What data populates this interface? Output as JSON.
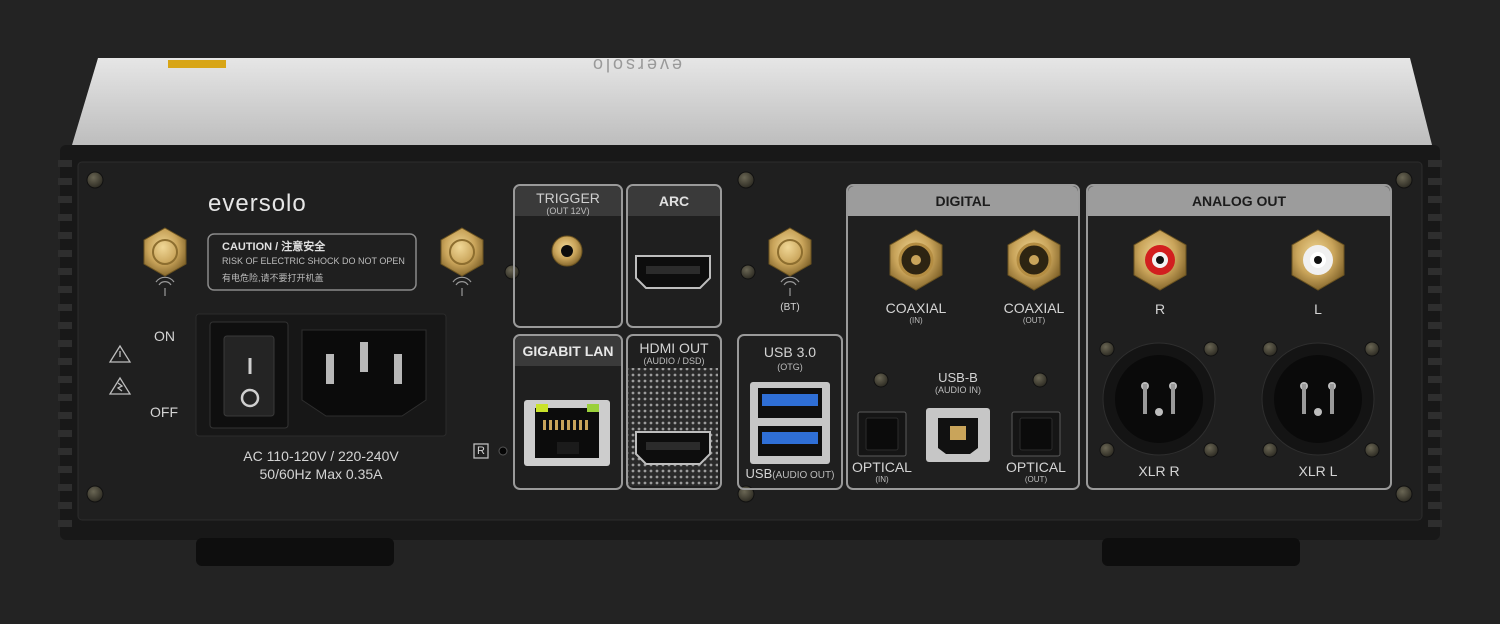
{
  "brand": {
    "logo_text": "eversolo",
    "lid_logo_text": "eversolo"
  },
  "caution": {
    "title": "CAUTION / 注意安全",
    "line1": "RISK OF ELECTRIC SHOCK DO NOT OPEN",
    "line2": "有电危险,请不要打开机盖"
  },
  "power": {
    "on_label": "ON",
    "off_label": "OFF",
    "switch_top": "I",
    "switch_bottom": "O",
    "rating_line1": "AC 110-120V / 220-240V",
    "rating_line2": "50/60Hz Max 0.35A"
  },
  "antenna": {
    "bt_label": "(BT)"
  },
  "reset": {
    "label": "R"
  },
  "ports": {
    "trigger": {
      "label": "TRIGGER",
      "sub": "(OUT 12V)"
    },
    "arc": {
      "label": "ARC"
    },
    "lan": {
      "label": "GIGABIT LAN"
    },
    "hdmi_out": {
      "label": "HDMI OUT",
      "sub": "(AUDIO / DSD)"
    },
    "usb3": {
      "label": "USB 3.0",
      "sub": "(OTG)",
      "bottom_label": "USB",
      "bottom_sub": "(AUDIO OUT)"
    },
    "digital": {
      "header": "DIGITAL",
      "coax_in": {
        "label": "COAXIAL",
        "sub": "(IN)"
      },
      "coax_out": {
        "label": "COAXIAL",
        "sub": "(OUT)"
      },
      "usb_b": {
        "label": "USB-B",
        "sub": "(AUDIO IN)"
      },
      "optical_in": {
        "label": "OPTICAL",
        "sub": "(IN)"
      },
      "optical_out": {
        "label": "OPTICAL",
        "sub": "(OUT)"
      }
    },
    "analog": {
      "header": "ANALOG OUT",
      "rca_r": "R",
      "rca_l": "L",
      "xlr_r": "XLR R",
      "xlr_l": "XLR L"
    }
  },
  "colors": {
    "background": "#232323",
    "panel": "#1e1e1e",
    "lid": "#d8d8d8",
    "gold": "#c9a45a",
    "label_text": "#d4d4d4",
    "header_fill": "#9c9c9c",
    "usb_blue": "#2f6fd6",
    "rca_red": "#d21f1f"
  }
}
